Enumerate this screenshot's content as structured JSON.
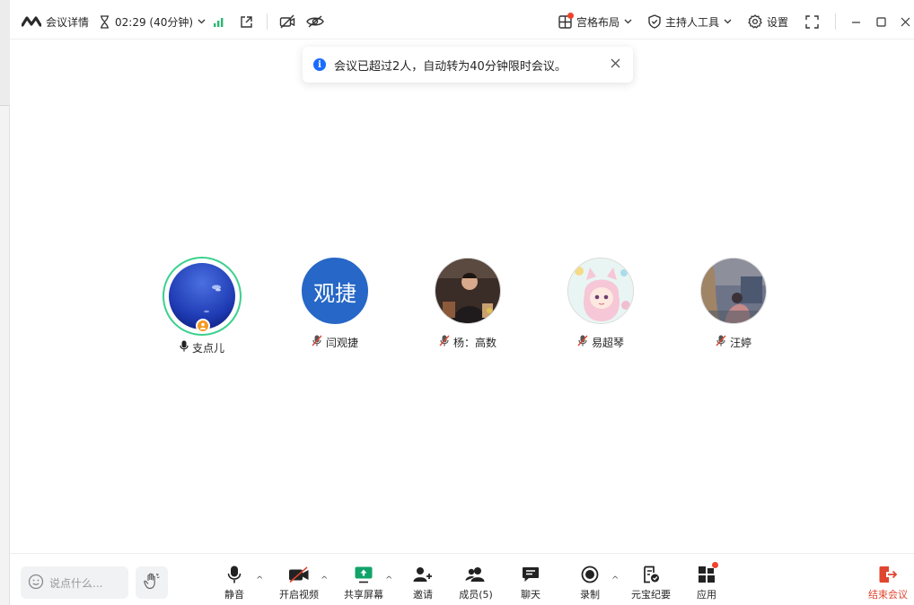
{
  "titlebar": {
    "meeting_details": "会议详情",
    "timer": "02:29 (40分钟)",
    "layout": "宫格布局",
    "host_tools": "主持人工具",
    "settings": "设置"
  },
  "toast": {
    "message": "会议已超过2人，自动转为40分钟限时会议。"
  },
  "participants": [
    {
      "name": "支点儿",
      "mic": "on",
      "speaking": true,
      "host": true
    },
    {
      "name": "闫观捷",
      "mic": "off",
      "avatar_text": "观捷"
    },
    {
      "name": "杨：高数",
      "mic": "off"
    },
    {
      "name": "易超琴",
      "mic": "off"
    },
    {
      "name": "汪婷",
      "mic": "off"
    }
  ],
  "toolbar": {
    "chat_placeholder": "说点什么...",
    "mute": "静音",
    "video": "开启视频",
    "share": "共享屏幕",
    "invite": "邀请",
    "members": "成员(5)",
    "chat": "聊天",
    "record": "录制",
    "yuanbao": "元宝纪要",
    "apps": "应用",
    "end": "结束会议"
  },
  "colors": {
    "accent": "#1a6cff",
    "speaking_ring": "#3bd08e",
    "signal": "#2bb673",
    "end": "#e0452f",
    "badge": "#f0432c",
    "host_badge": "#f59a23"
  },
  "icons": [
    "tencent-meeting-logo-icon",
    "hourglass-icon",
    "chevron-down-icon",
    "signal-icon",
    "external-window-icon",
    "video-off-icon",
    "eye-off-icon",
    "grid-layout-icon",
    "shield-icon",
    "gear-icon",
    "fullscreen-icon",
    "minimize-icon",
    "maximize-icon",
    "close-icon",
    "info-icon",
    "mic-icon",
    "mic-off-icon",
    "smiley-icon",
    "raise-hand-icon",
    "camera-off-icon",
    "share-screen-icon",
    "add-user-icon",
    "members-icon",
    "chat-icon",
    "record-icon",
    "yuanbao-icon",
    "apps-icon",
    "exit-icon"
  ]
}
